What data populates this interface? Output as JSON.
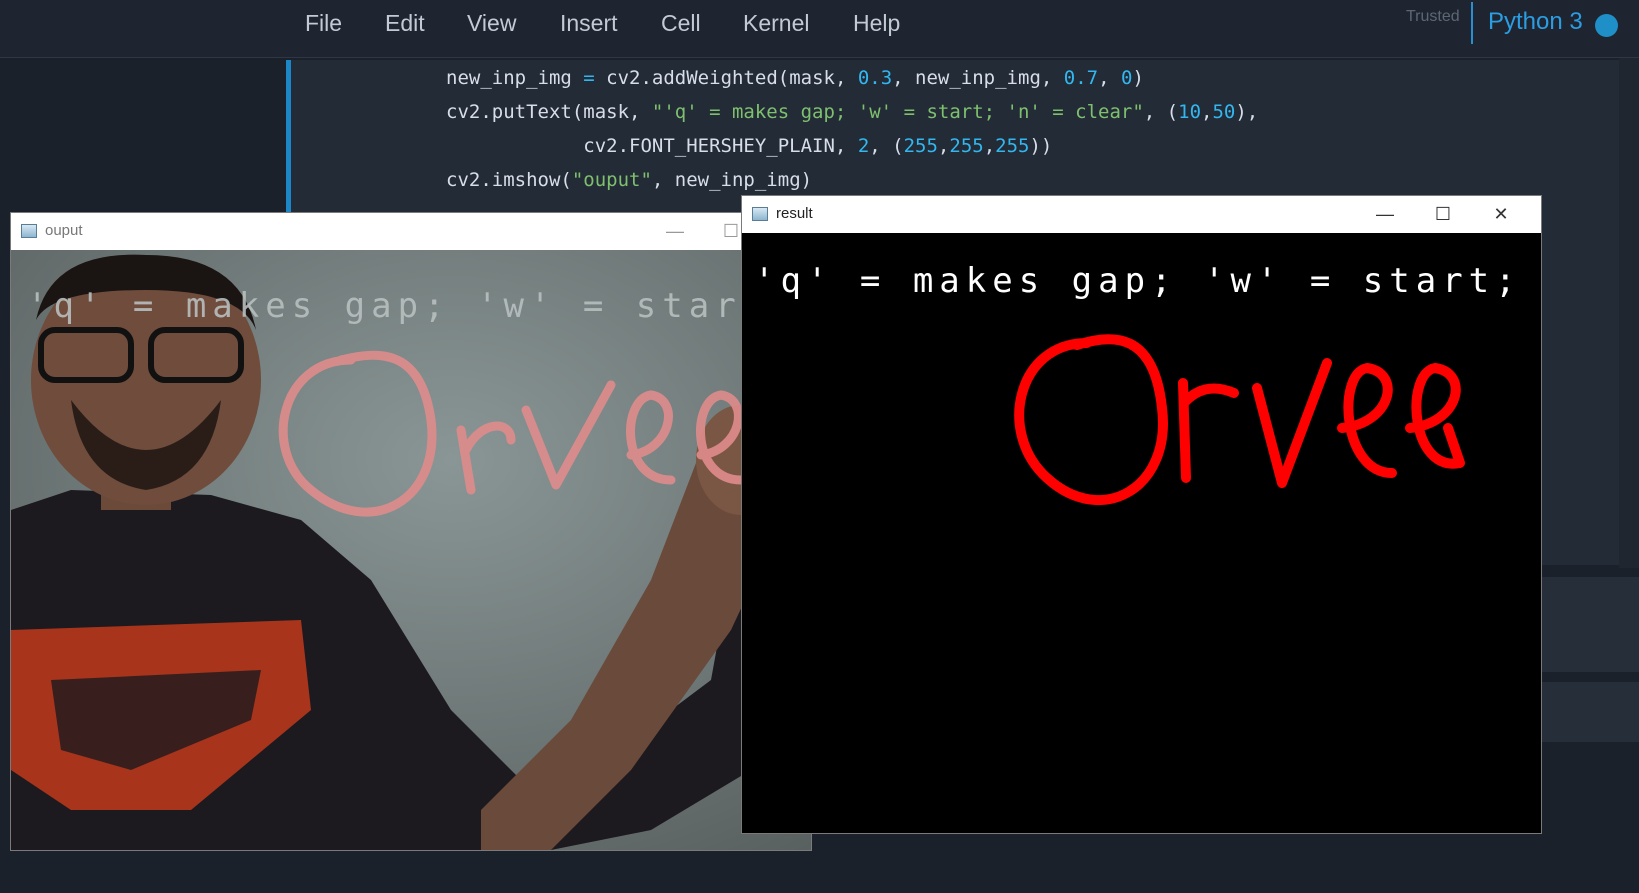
{
  "menu": {
    "items": [
      "File",
      "Edit",
      "View",
      "Insert",
      "Cell",
      "Kernel",
      "Help"
    ],
    "trusted_label": "Trusted",
    "kernel_label": "Python 3"
  },
  "code": {
    "line1": {
      "a": "new_inp_img ",
      "b": "=",
      "c": " cv2.addWeighted(mask, ",
      "d": "0.3",
      "e": ", new_inp_img, ",
      "f": "0.7",
      "g": ", ",
      "h": "0",
      "i": ")"
    },
    "line2": {
      "a": "cv2.putText(mask, ",
      "b": "\"'q' = makes gap; 'w' = start; 'n' = clear\"",
      "c": ", (",
      "d": "10",
      "e": ",",
      "f": "50",
      "g": "),"
    },
    "line3": {
      "a": "            cv2.FONT_HERSHEY_PLAIN, ",
      "b": "2",
      "c": ", (",
      "d": "255",
      "e": ",",
      "f": "255",
      "g": ",",
      "h": "255",
      "i": "))"
    },
    "line4": {
      "a": "cv2.imshow(",
      "b": "\"ouput\"",
      "c": ", new_inp_img)"
    }
  },
  "windows": {
    "output": {
      "title": "ouput",
      "overlay_text": "'q' = makes gap; 'w' = start; 'n' = clear",
      "drawing_text": "Orvee"
    },
    "result": {
      "title": "result",
      "overlay_text": "'q' = makes gap; 'w' = start; 'n' = clear",
      "drawing_text": "Orvee",
      "minimize_glyph": "—",
      "maximize_glyph": "☐",
      "close_glyph": "✕"
    }
  },
  "colors": {
    "accent": "#1c86c6",
    "drawing_red": "#ff0000",
    "pointer_green": "#1fb51f"
  }
}
